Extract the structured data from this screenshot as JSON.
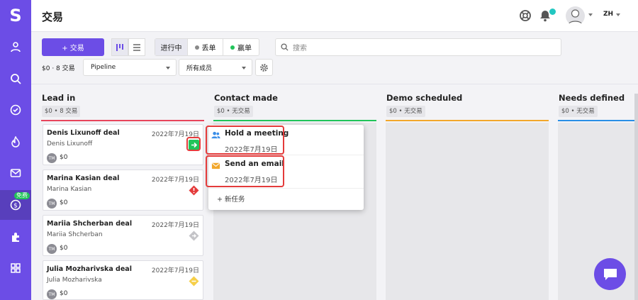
{
  "app": {
    "logo": "S",
    "title": "交易",
    "lang": "ZH",
    "free_badge": "免费"
  },
  "sidebar": {
    "items": [
      "contacts-icon",
      "search-icon",
      "tasks-icon",
      "funnel-icon",
      "mail-icon",
      "deals-icon",
      "apps-icon",
      "dashboard-icon"
    ],
    "active": "deals-icon"
  },
  "toolbar": {
    "add_label": "+ 交易",
    "seg": [
      "进行中",
      "丢单",
      "赢单"
    ],
    "seg_colors": [
      "#8a8a8a",
      "#21c45a"
    ],
    "search_placeholder": "搜索",
    "summary": "$0 · 8 交易",
    "pipeline": "Pipeline",
    "members": "所有成员"
  },
  "columns": [
    {
      "name": "Lead in",
      "sub": "$0 • 8 交易",
      "color": "#e8455c"
    },
    {
      "name": "Contact made",
      "sub": "$0 • 无交易",
      "color": "#21c45a"
    },
    {
      "name": "Demo scheduled",
      "sub": "$0 • 无交易",
      "color": "#f2a72b"
    },
    {
      "name": "Needs defined",
      "sub": "$0 • 无交易",
      "color": "#2a8fe6"
    }
  ],
  "cards": [
    {
      "name": "Denis Lixunoff deal",
      "date": "2022年7月19日",
      "person": "Denis Lixunoff",
      "value": "$0",
      "initials": "TM",
      "status": "arrow-right-icon"
    },
    {
      "name": "Marina Kasian deal",
      "date": "2022年7月19日",
      "person": "Marina Kasian",
      "value": "$0",
      "initials": "TM",
      "status": "warning-icon"
    },
    {
      "name": "Mariia Shcherban deal",
      "date": "2022年7月19日",
      "person": "Mariia Shcherban",
      "value": "$0",
      "initials": "TM",
      "status": "diamond-icon"
    },
    {
      "name": "Julia Mozharivska deal",
      "date": "2022年7月19日",
      "person": "Julia Mozharivska",
      "value": "$0",
      "initials": "TM",
      "status": "yellow-diamond-icon"
    }
  ],
  "popup": {
    "items": [
      {
        "title": "Hold a meeting",
        "date": "2022年7月19日",
        "icon": "meeting-icon"
      },
      {
        "title": "Send an email",
        "date": "2022年7月19日",
        "icon": "email-icon"
      }
    ],
    "new_task": "+ 新任务"
  }
}
